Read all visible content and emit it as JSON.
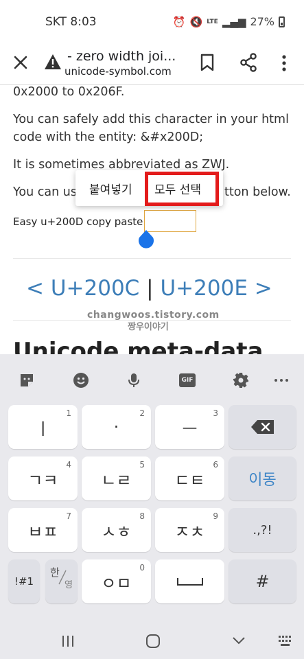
{
  "status": {
    "carrier_time": "SKT 8:03",
    "battery": "27%",
    "lte": "LTE"
  },
  "app_bar": {
    "title": "- zero width joi...",
    "url": "unicode-symbol.com"
  },
  "content": {
    "line1": "0x2000 to 0x206F.",
    "line2": "You can safely add this character in your html",
    "line3": "code with the entity: &#x200D;",
    "line4": "It is sometimes abbreviated as ZWJ.",
    "line5_left": "You can us",
    "line5_right": "tton below.",
    "copy_label": "Easy u+200D copy paste:",
    "nav_prev": "<  U+200C",
    "nav_sep": "|",
    "nav_next": "U+200E  >",
    "watermark_line1": "changwoos.tistory.com",
    "watermark_line2": "짱우이야기",
    "meta_heading": "Unicode meta-data"
  },
  "context_menu": {
    "paste": "붙여넣기",
    "select_all": "모두 선택"
  },
  "keyboard": {
    "row1": [
      {
        "label": "ㅣ",
        "num": "1"
      },
      {
        "label": "·",
        "num": "2"
      },
      {
        "label": "ㅡ",
        "num": "3"
      }
    ],
    "row2": [
      {
        "label": "ㄱㅋ",
        "num": "4"
      },
      {
        "label": "ㄴㄹ",
        "num": "5"
      },
      {
        "label": "ㄷㅌ",
        "num": "6"
      }
    ],
    "row3": [
      {
        "label": "ㅂㅍ",
        "num": "7"
      },
      {
        "label": "ㅅㅎ",
        "num": "8"
      },
      {
        "label": "ㅈㅊ",
        "num": "9"
      }
    ],
    "row4": [
      {
        "label": "ㅇㅁ",
        "num": "0"
      }
    ],
    "enter_label": "이동",
    "punct_label": ".,?!",
    "symbol_label": "!#1",
    "lang_top": "한",
    "lang_bottom": "영",
    "hash_label": "#",
    "gif_label": "GIF"
  },
  "colors": {
    "accent": "#3d7eb8",
    "highlight": "#e31b1b",
    "handle": "#1a73e8"
  }
}
